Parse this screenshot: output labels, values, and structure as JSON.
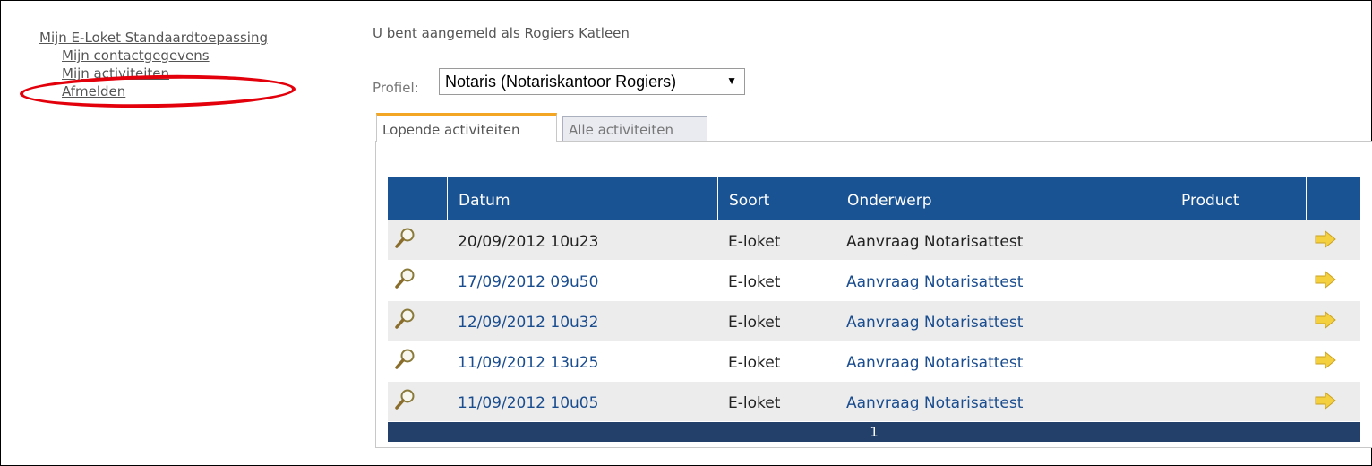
{
  "sidebar": {
    "main_link": "Mijn E-Loket Standaardtoepassing",
    "items": [
      {
        "label": "Mijn contactgegevens"
      },
      {
        "label": "Mijn activiteiten"
      },
      {
        "label": "Afmelden"
      }
    ],
    "highlight_color": "#e3000b"
  },
  "header": {
    "logged_in_text": "U bent aangemeld als Rogiers Katleen",
    "profile_label": "Profiel:",
    "profile_value": "Notaris (Notariskantoor Rogiers)"
  },
  "tabs": [
    {
      "label": "Lopende activiteiten",
      "active": true
    },
    {
      "label": "Alle activiteiten",
      "active": false
    }
  ],
  "table": {
    "columns": [
      "Datum",
      "Soort",
      "Onderwerp",
      "Product"
    ],
    "rows": [
      {
        "datum": "20/09/2012 10u23",
        "soort": "E-loket",
        "onderwerp": "Aanvraag Notarisattest",
        "product": ""
      },
      {
        "datum": "17/09/2012 09u50",
        "soort": "E-loket",
        "onderwerp": "Aanvraag Notarisattest",
        "product": ""
      },
      {
        "datum": "12/09/2012 10u32",
        "soort": "E-loket",
        "onderwerp": "Aanvraag Notarisattest",
        "product": ""
      },
      {
        "datum": "11/09/2012 13u25",
        "soort": "E-loket",
        "onderwerp": "Aanvraag Notarisattest",
        "product": ""
      },
      {
        "datum": "11/09/2012 10u05",
        "soort": "E-loket",
        "onderwerp": "Aanvraag Notarisattest",
        "product": ""
      }
    ],
    "page": "1",
    "header_color": "#1a5393",
    "pager_color": "#23406b"
  },
  "icons": {
    "row_view": "magnifier-icon",
    "row_open": "arrow-right-icon"
  }
}
